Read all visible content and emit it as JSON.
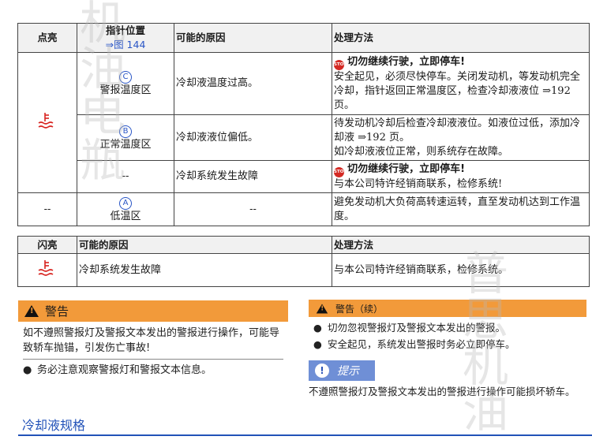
{
  "watermark": {
    "left_chars": [
      "机",
      "油",
      "电",
      "瓶"
    ],
    "right_chars": [
      "普",
      "思",
      "机",
      "油"
    ]
  },
  "table1": {
    "headers": {
      "lit": "点亮",
      "position": "指针位置",
      "position_ref": "⇒图 144",
      "cause": "可能的原因",
      "action": "处理方法"
    },
    "rows": [
      {
        "zone_letter": "C",
        "zone_label": "警报温度区",
        "cause": "冷却液温度过高。",
        "action_stop": "切勿继续行驶，立即停车!",
        "action_text": "安全起见，必须尽快停车。关闭发动机，等发动机完全冷却，指针返回正常温度区，检查冷却液液位 ⇒192 页。"
      },
      {
        "zone_letter": "B",
        "zone_label": "正常温度区",
        "cause": "冷却液液位偏低。",
        "action_text": "待发动机冷却后检查冷却液液位。如液位过低，添加冷却液 ⇒192 页。",
        "action_text2": "如冷却液液位正常，则系统存在故障。"
      },
      {
        "zone_label": "--",
        "cause": "冷却系统发生故障",
        "action_stop": "切勿继续行驶，立即停车!",
        "action_text": "与本公司特许经销商联系，检修系统!"
      },
      {
        "lit": "--",
        "zone_letter": "A",
        "zone_label": "低温区",
        "cause": "--",
        "action_text": "避免发动机大负荷高转速运转，直至发动机达到工作温度。"
      }
    ]
  },
  "table2": {
    "headers": {
      "flash": "闪亮",
      "cause": "可能的原因",
      "action": "处理方法"
    },
    "row": {
      "cause": "冷却系统发生故障",
      "action": "与本公司特许经销商联系，检修系统。"
    }
  },
  "warning": {
    "title": "警告",
    "text": "如不遵照警报灯及警报文本发出的警报进行操作，可能导致轿车抛锚，引发伤亡事故!",
    "bullets": [
      "务必注意观察警报灯和警报文本信息。"
    ]
  },
  "warning_cont": {
    "title": "警告（续）",
    "bullets": [
      "切勿忽视警报灯及警报文本发出的警报。",
      "安全起见，系统发出警报时务必立即停车。"
    ]
  },
  "note": {
    "title": "提示",
    "text": "不遵照警报灯及警报文本发出的警报进行操作可能损坏轿车。"
  },
  "section_title": "冷却液规格",
  "colors": {
    "warning_orange": "#f29a3a",
    "note_blue": "#6f8fd6",
    "heading_blue": "#2252b8",
    "stop_red": "#d42a24",
    "icon_red": "#d8231f"
  },
  "icons": {
    "coolant_temp": "coolant-temperature-warning-icon",
    "stop": "stop-icon",
    "warning": "warning-triangle-icon",
    "info": "info-icon"
  }
}
